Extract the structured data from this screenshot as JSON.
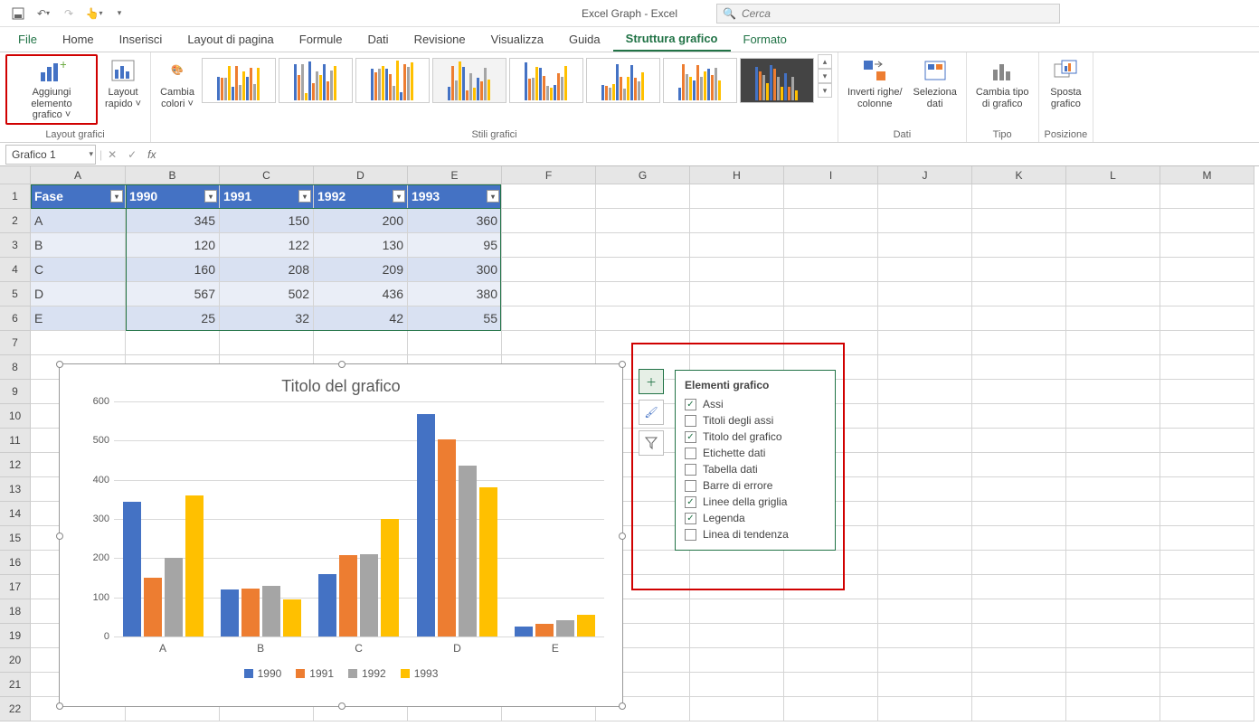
{
  "titlebar": {
    "title": "Excel Graph  -  Excel",
    "search_placeholder": "Cerca"
  },
  "tabs": {
    "file": "File",
    "home": "Home",
    "inserisci": "Inserisci",
    "layout": "Layout di pagina",
    "formule": "Formule",
    "dati": "Dati",
    "revisione": "Revisione",
    "visualizza": "Visualizza",
    "guida": "Guida",
    "struttura": "Struttura grafico",
    "formato": "Formato"
  },
  "ribbon": {
    "layout_grafici": {
      "aggiungi": "Aggiungi elemento\ngrafico ˅",
      "layout_rapido": "Layout\nrapido ˅",
      "group": "Layout grafici"
    },
    "stili": {
      "cambia_colori": "Cambia\ncolori ˅",
      "group": "Stili grafici"
    },
    "dati": {
      "inverti": "Inverti righe/\ncolonne",
      "seleziona": "Seleziona\ndati",
      "group": "Dati"
    },
    "tipo": {
      "cambia": "Cambia tipo\ndi grafico",
      "group": "Tipo"
    },
    "posizione": {
      "sposta": "Sposta\ngrafico",
      "group": "Posizione"
    }
  },
  "namebox": {
    "value": "Grafico 1"
  },
  "table": {
    "headers": [
      "Fase",
      "1990",
      "1991",
      "1992",
      "1993"
    ],
    "rows": [
      [
        "A",
        "345",
        "150",
        "200",
        "360"
      ],
      [
        "B",
        "120",
        "122",
        "130",
        "95"
      ],
      [
        "C",
        "160",
        "208",
        "209",
        "300"
      ],
      [
        "D",
        "567",
        "502",
        "436",
        "380"
      ],
      [
        "E",
        "25",
        "32",
        "42",
        "55"
      ]
    ]
  },
  "chart": {
    "title": "Titolo del grafico",
    "y_ticks": [
      "0",
      "100",
      "200",
      "300",
      "400",
      "500",
      "600"
    ],
    "x_labels": [
      "A",
      "B",
      "C",
      "D",
      "E"
    ],
    "legend": [
      "1990",
      "1991",
      "1992",
      "1993"
    ]
  },
  "elements_panel": {
    "title": "Elementi grafico",
    "items": [
      {
        "label": "Assi",
        "checked": true
      },
      {
        "label": "Titoli degli assi",
        "checked": false
      },
      {
        "label": "Titolo del grafico",
        "checked": true
      },
      {
        "label": "Etichette dati",
        "checked": false
      },
      {
        "label": "Tabella dati",
        "checked": false
      },
      {
        "label": "Barre di errore",
        "checked": false
      },
      {
        "label": "Linee della griglia",
        "checked": true
      },
      {
        "label": "Legenda",
        "checked": true
      },
      {
        "label": "Linea di tendenza",
        "checked": false
      }
    ]
  },
  "chart_data": {
    "type": "bar",
    "categories": [
      "A",
      "B",
      "C",
      "D",
      "E"
    ],
    "series": [
      {
        "name": "1990",
        "values": [
          345,
          120,
          160,
          567,
          25
        ]
      },
      {
        "name": "1991",
        "values": [
          150,
          122,
          208,
          502,
          32
        ]
      },
      {
        "name": "1992",
        "values": [
          200,
          130,
          209,
          436,
          42
        ]
      },
      {
        "name": "1993",
        "values": [
          360,
          95,
          300,
          380,
          55
        ]
      }
    ],
    "title": "Titolo del grafico",
    "xlabel": "",
    "ylabel": "",
    "ylim": [
      0,
      600
    ]
  },
  "columns": [
    "A",
    "B",
    "C",
    "D",
    "E",
    "F",
    "G",
    "H",
    "I",
    "J",
    "K",
    "L",
    "M"
  ]
}
